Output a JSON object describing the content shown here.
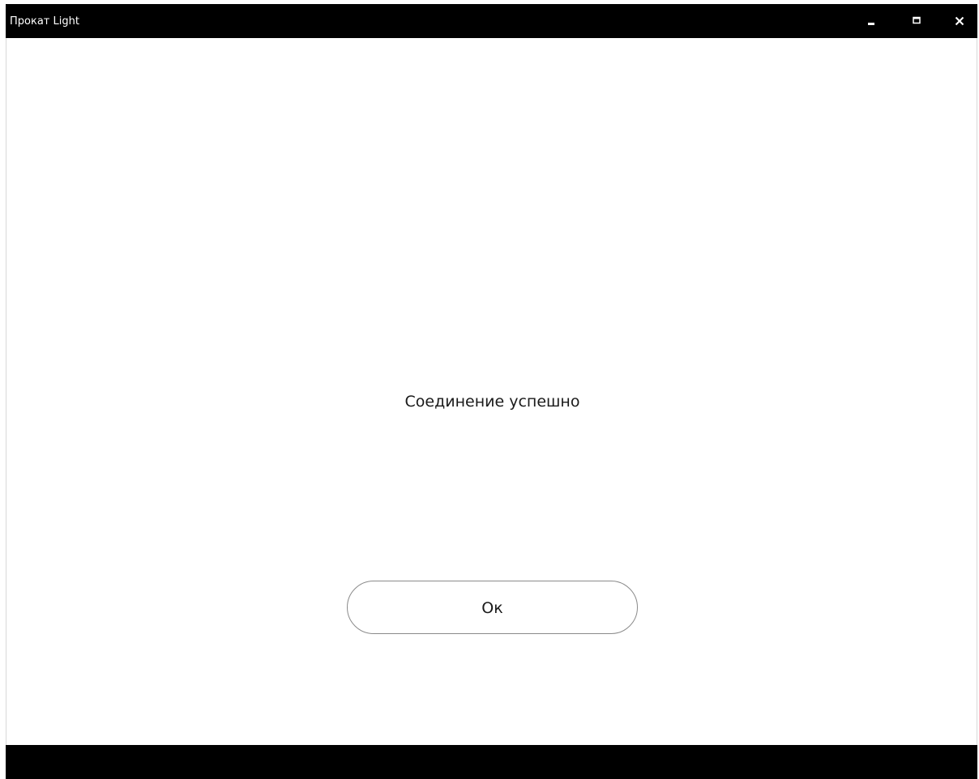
{
  "window": {
    "title": "Прокат Light",
    "controls": {
      "minimize_icon": "minimize-icon",
      "maximize_icon": "maximize-icon",
      "close_icon": "close-icon"
    }
  },
  "dialog": {
    "message": "Соединение успешно",
    "ok_label": "Ок"
  },
  "colors": {
    "titlebar": "#000000",
    "background": "#ffffff",
    "bottombar": "#000000",
    "button_border": "#8a8a8a"
  }
}
